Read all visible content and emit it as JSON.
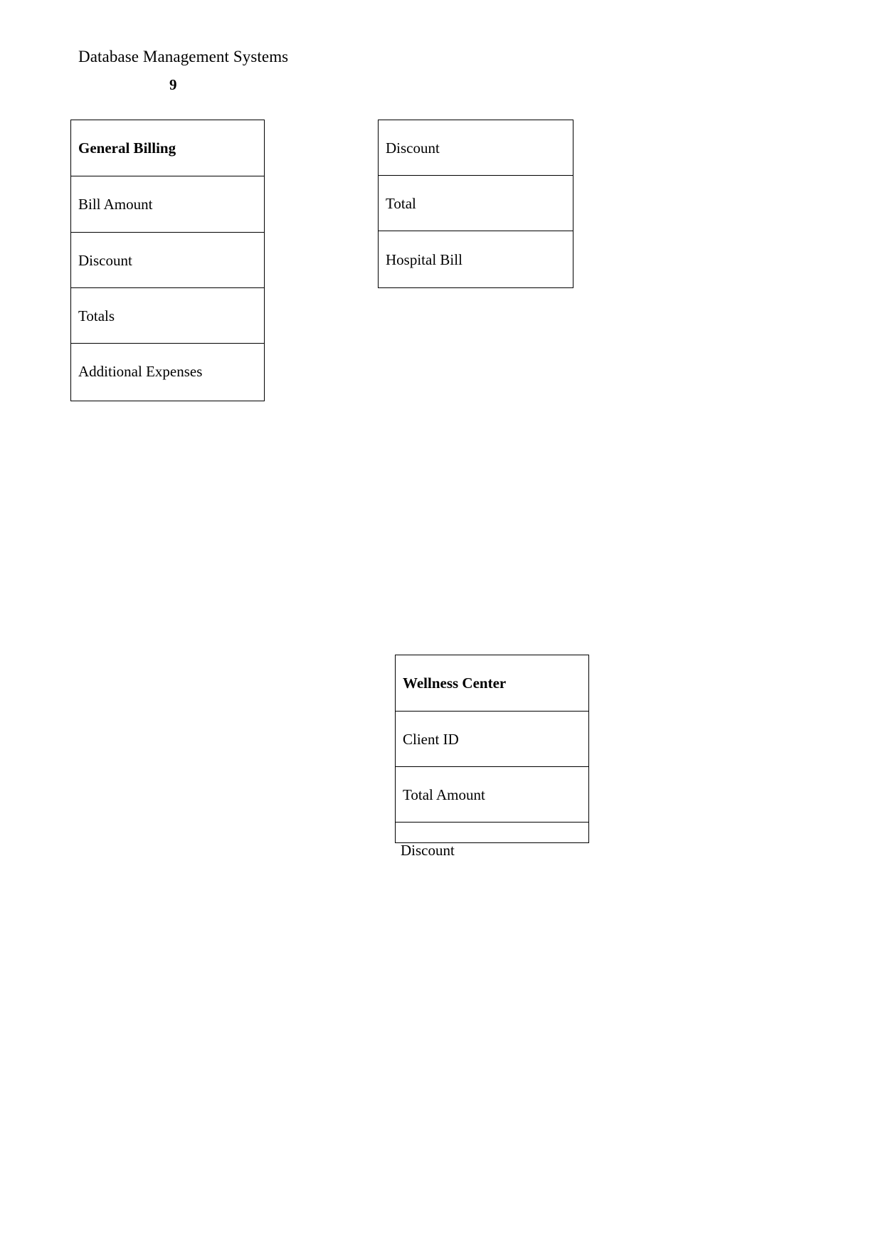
{
  "document": {
    "title": "Database Management Systems",
    "page_number": "9"
  },
  "tables": {
    "general_billing": {
      "header": "General Billing",
      "rows": [
        "Bill Amount",
        "Discount",
        "Totals",
        "Additional Expenses"
      ]
    },
    "hospital_bill": {
      "rows": [
        "Discount",
        "Total",
        "Hospital Bill"
      ]
    },
    "wellness_center": {
      "header": "Wellness Center",
      "rows": [
        "Client ID",
        "Total Amount",
        ""
      ],
      "overflow_label": "Discount"
    }
  },
  "colors": {
    "page_background": "#ffffff",
    "text": "#000000",
    "table_border": "#000000"
  }
}
